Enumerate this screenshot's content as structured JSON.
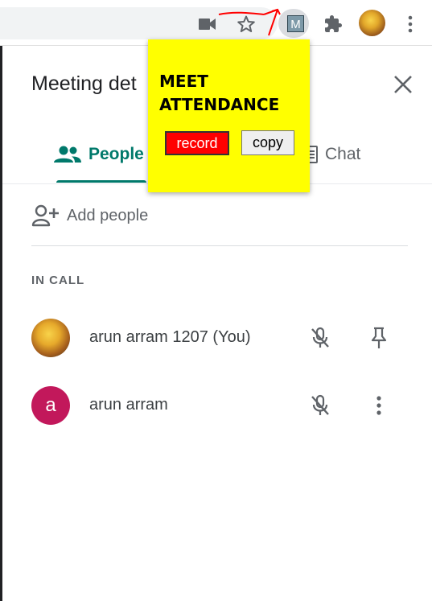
{
  "browser": {
    "toolbar_icons": [
      "video-camera-icon",
      "star-icon",
      "extension-m-icon",
      "puzzle-icon",
      "avatar",
      "more-vert-icon"
    ],
    "extension_letter": "M"
  },
  "popup": {
    "title": "MEET ATTENDANCE",
    "record_label": "record",
    "copy_label": "copy",
    "background": "#ffff00",
    "record_color": "#ff0000"
  },
  "panel": {
    "title": "Meeting det",
    "tabs": [
      {
        "label": "People",
        "active": true,
        "icon": "people-icon"
      },
      {
        "label": "Chat",
        "active": false,
        "icon": "chat-icon"
      }
    ],
    "add_people_label": "Add people",
    "section_label": "IN CALL",
    "accent": "#00796b",
    "participants": [
      {
        "name": "arun arram 1207 (You)",
        "avatar": "photo",
        "actions": [
          "mic-off-icon",
          "pin-icon"
        ]
      },
      {
        "name": "arun arram",
        "avatar": "a",
        "avatar_color": "#c2185b",
        "actions": [
          "mic-off-icon",
          "more-vert-icon"
        ]
      }
    ]
  }
}
